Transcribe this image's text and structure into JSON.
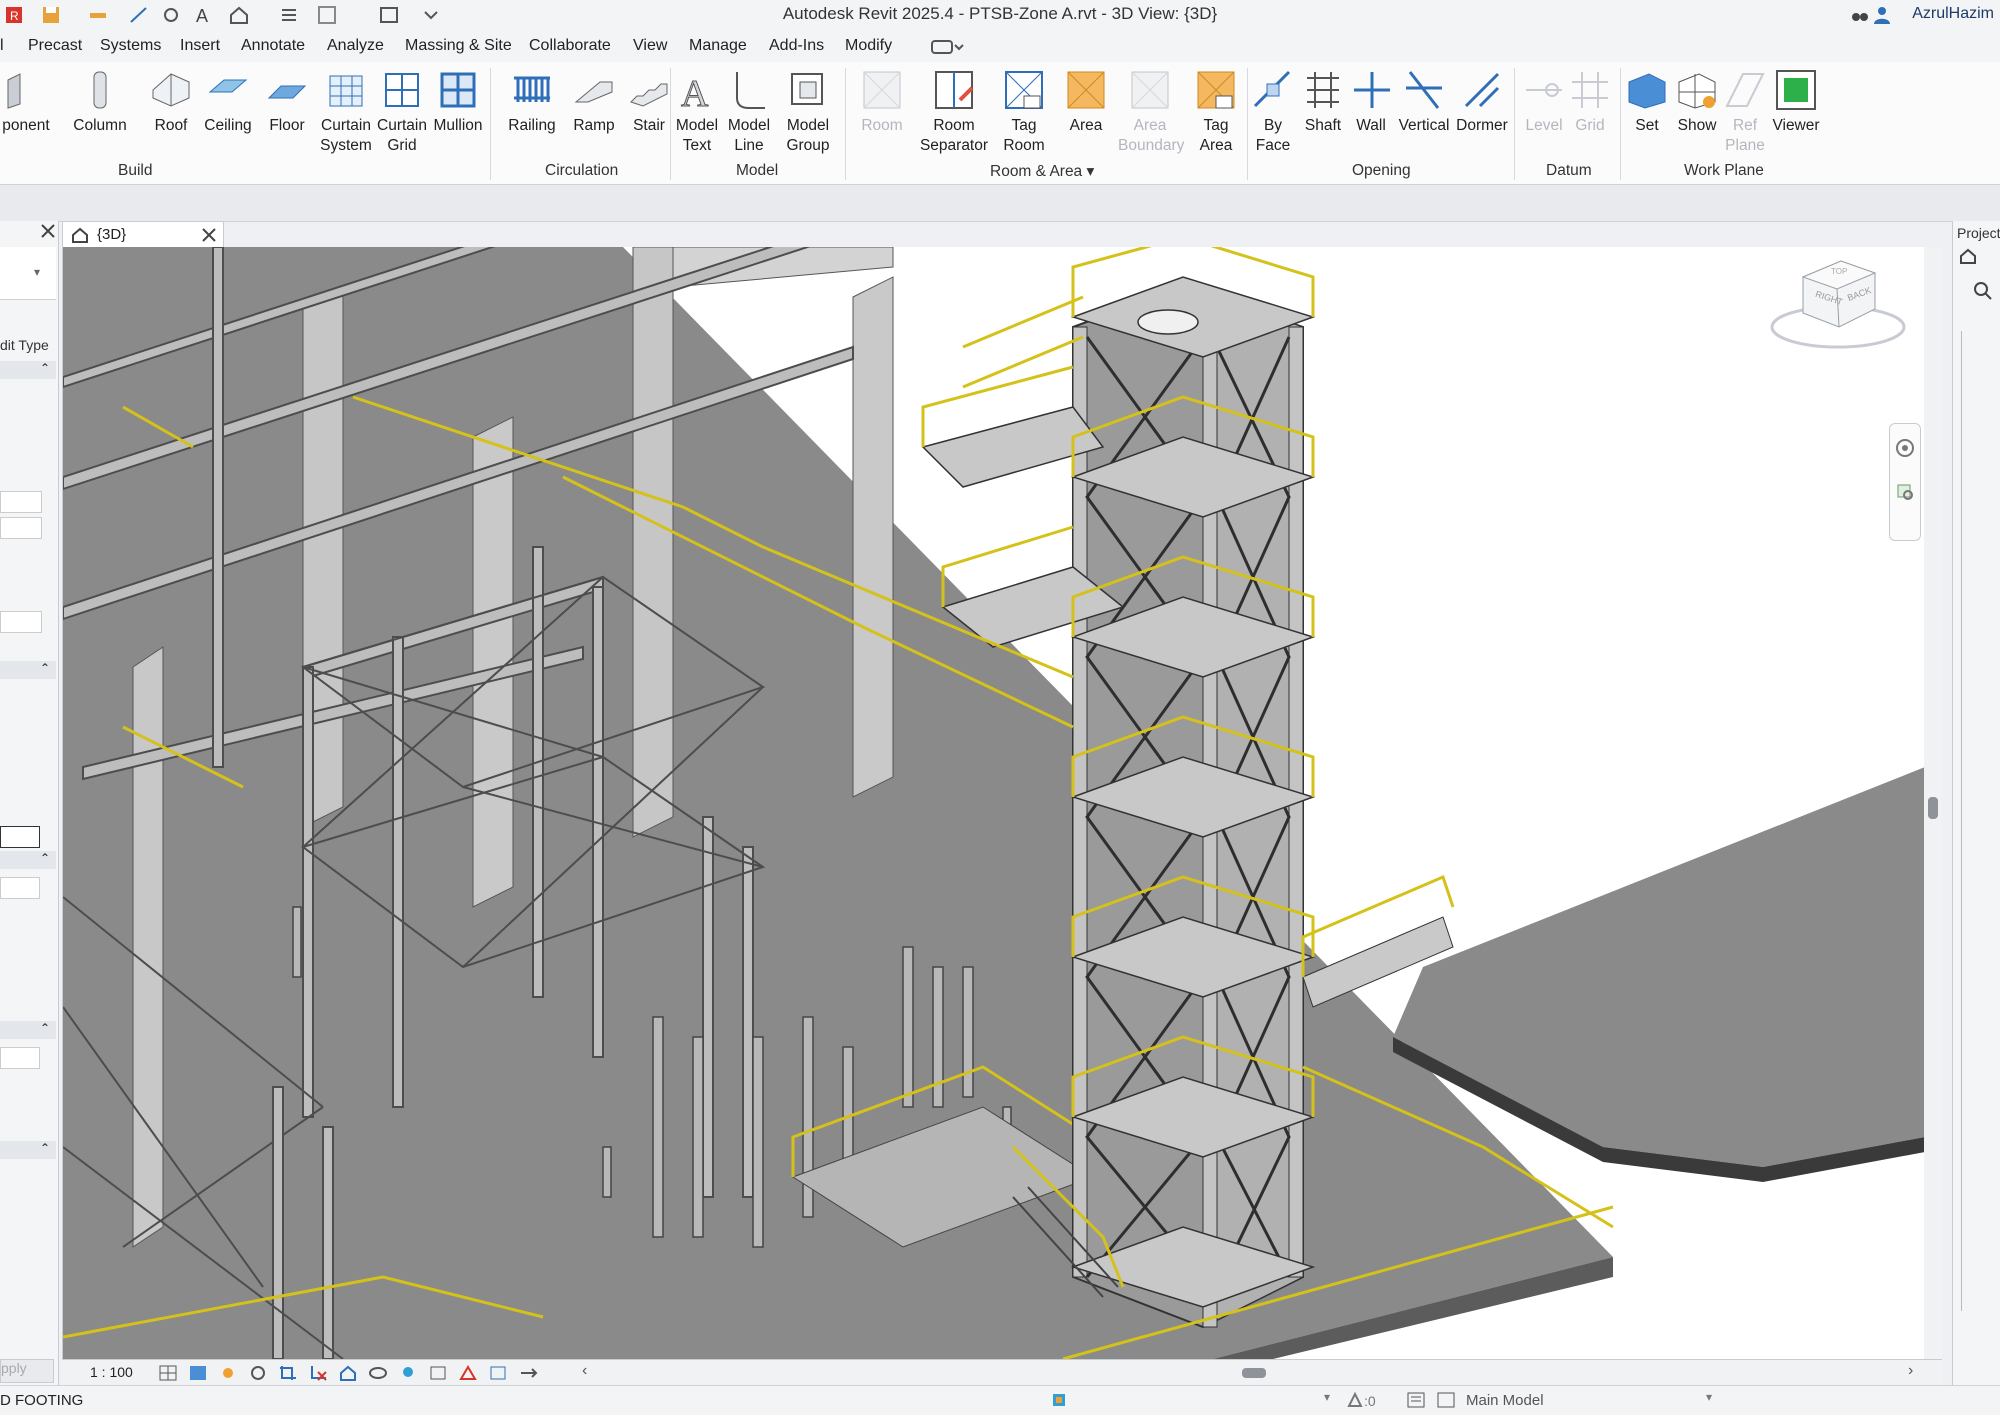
{
  "window": {
    "title": "Autodesk Revit 2025.4 - PTSB-Zone A.rvt - 3D View: {3D}",
    "user": "AzrulHazim"
  },
  "menu": {
    "tabs": [
      "Precast",
      "Systems",
      "Insert",
      "Annotate",
      "Analyze",
      "Massing & Site",
      "Collaborate",
      "View",
      "Manage",
      "Add-Ins",
      "Modify"
    ],
    "partial_first": "l"
  },
  "ribbon": {
    "build": {
      "label": "Build",
      "component": "ponent",
      "column": "Column",
      "roof": "Roof",
      "ceiling": "Ceiling",
      "floor": "Floor",
      "curtain_system": [
        "Curtain",
        "System"
      ],
      "curtain_grid": [
        "Curtain",
        "Grid"
      ],
      "mullion": "Mullion"
    },
    "circulation": {
      "label": "Circulation",
      "railing": "Railing",
      "ramp": "Ramp",
      "stair": "Stair"
    },
    "model": {
      "label": "Model",
      "model_text": [
        "Model",
        "Text"
      ],
      "model_line": [
        "Model",
        "Line"
      ],
      "model_group": [
        "Model",
        "Group"
      ]
    },
    "room_area": {
      "label": "Room & Area",
      "room": "Room",
      "room_separator": [
        "Room",
        "Separator"
      ],
      "tag_room": [
        "Tag",
        "Room"
      ],
      "area": "Area",
      "area_boundary": [
        "Area",
        "Boundary"
      ],
      "tag_area": [
        "Tag",
        "Area"
      ]
    },
    "opening": {
      "label": "Opening",
      "by_face": [
        "By",
        "Face"
      ],
      "shaft": "Shaft",
      "wall": "Wall",
      "vertical": "Vertical",
      "dormer": "Dormer"
    },
    "datum": {
      "label": "Datum",
      "level": "Level",
      "grid": "Grid"
    },
    "work_plane": {
      "label": "Work Plane",
      "set": "Set",
      "show": "Show",
      "ref_plane": [
        "Ref",
        "Plane"
      ],
      "viewer": "Viewer"
    }
  },
  "view_tab": {
    "label": "{3D}"
  },
  "left_panel": {
    "edit_type_fragment": "dit Type",
    "apply_fragment": "pply"
  },
  "right_panel": {
    "title_fragment": "Project"
  },
  "viewcube": {
    "face_right": "RIGHT",
    "face_back": "BACK",
    "face_top": "TOP"
  },
  "view_control": {
    "scale": "1 : 100"
  },
  "status": {
    "left": "D FOOTING",
    "worksets": ":0",
    "model": "Main Model"
  },
  "colors": {
    "steel": "#a9a9a9",
    "steel_dark": "#6e6e6e",
    "slab": "#8c8c8c",
    "railing": "#d4c21a",
    "concrete": "#c9c9c9",
    "ribbon_blue": "#2f6fb8",
    "ribbon_orange": "#f0a030"
  }
}
